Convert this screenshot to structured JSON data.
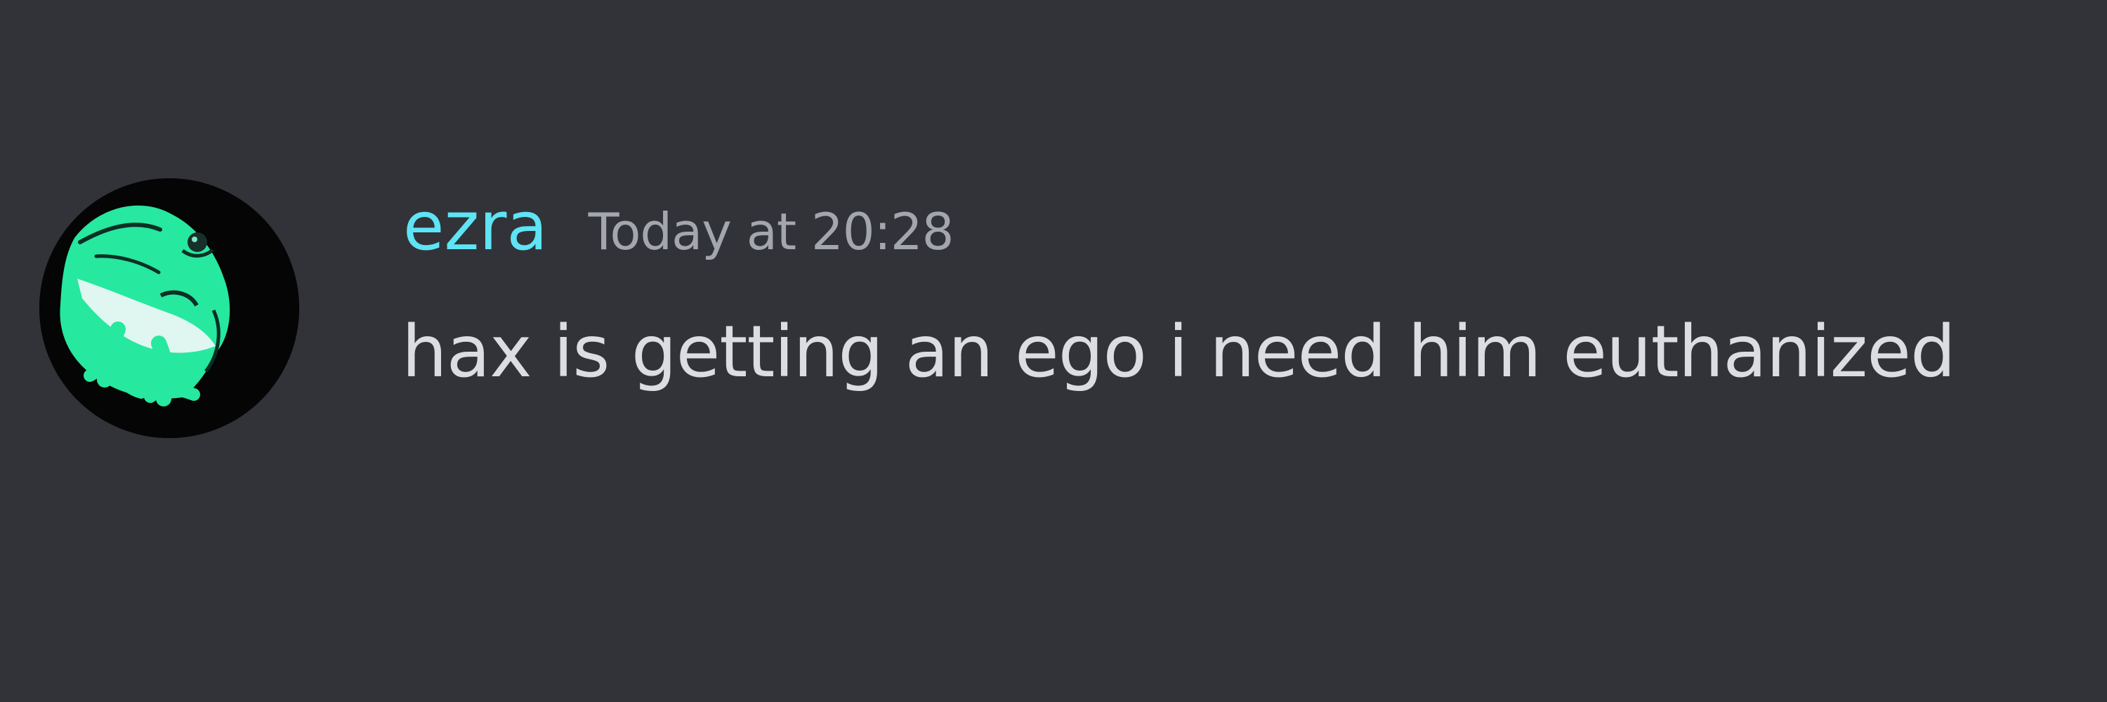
{
  "message": {
    "author": {
      "name": "ezra",
      "name_color": "#5ee4f5",
      "avatar_icon": "frog-avatar-icon"
    },
    "timestamp": "Today at 20:28",
    "content": "hax is getting an ego i need him euthanized"
  },
  "theme": {
    "background": "#313338",
    "text": "#dcdde1",
    "muted": "#a3a6ad",
    "avatar_green": "#26e89f"
  }
}
